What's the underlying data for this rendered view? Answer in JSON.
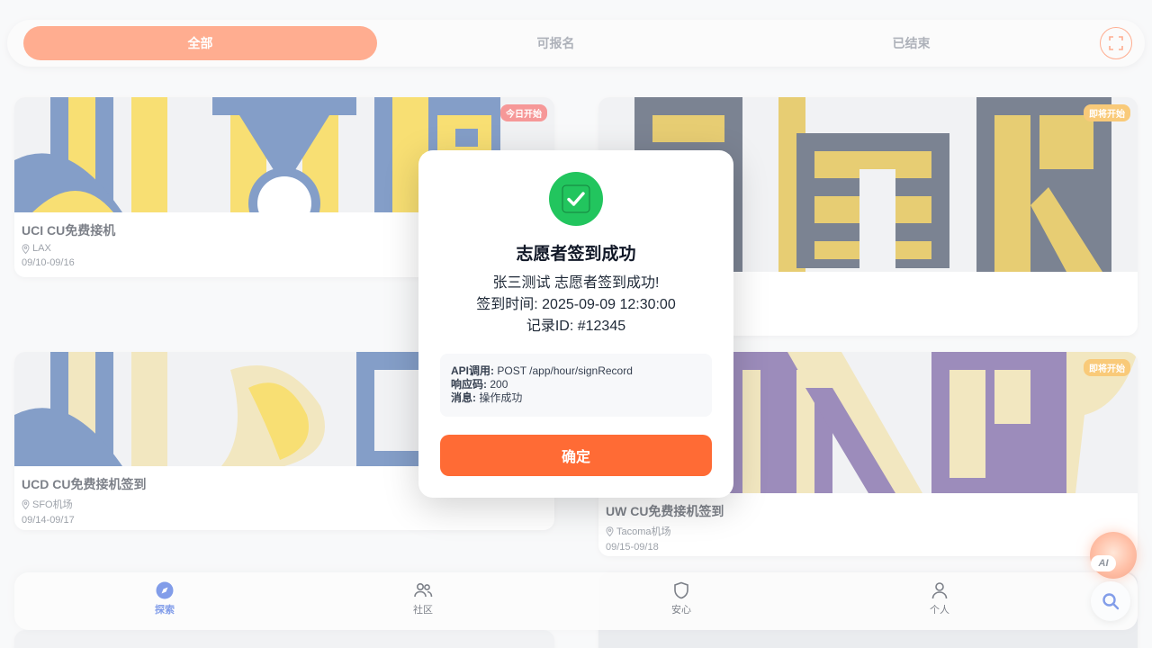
{
  "filters": {
    "all": "全部",
    "open": "可报名",
    "ended": "已结束"
  },
  "cards": [
    {
      "title": "UCI CU免费接机",
      "location": "LAX",
      "date": "09/10-09/16",
      "badge": "今日开始",
      "badge_color": "#ef4444"
    },
    {
      "title": "",
      "location": "",
      "date": "",
      "badge": "即将开始",
      "badge_color": "#f59e0b"
    },
    {
      "title": "UCD CU免费接机签到",
      "location": "SFO机场",
      "date": "09/14-09/17",
      "badge": "",
      "badge_color": ""
    },
    {
      "title": "UW CU免费接机签到",
      "location": "Tacoma机场",
      "date": "09/15-09/18",
      "badge": "即将开始",
      "badge_color": "#f59e0b"
    }
  ],
  "nav": {
    "explore": "探索",
    "community": "社区",
    "safety": "安心",
    "profile": "个人"
  },
  "ai_label": "AI",
  "modal": {
    "title": "志愿者签到成功",
    "line1": "张三测试 志愿者签到成功!",
    "line2": "签到时间: 2025-09-09 12:30:00",
    "line3": "记录ID: #12345",
    "api_label": "API调用:",
    "api_value": "POST /app/hour/signRecord",
    "code_label": "响应码:",
    "code_value": "200",
    "msg_label": "消息:",
    "msg_value": "操作成功",
    "confirm": "确定"
  },
  "colors": {
    "accent": "#ff6b35",
    "success": "#22c55e",
    "nav_active": "#1d4ed8",
    "uc_blue": "#1f4f9c",
    "uc_gold": "#f2c500",
    "uw_purple": "#4b2e83",
    "uw_gold": "#e8d38c"
  }
}
